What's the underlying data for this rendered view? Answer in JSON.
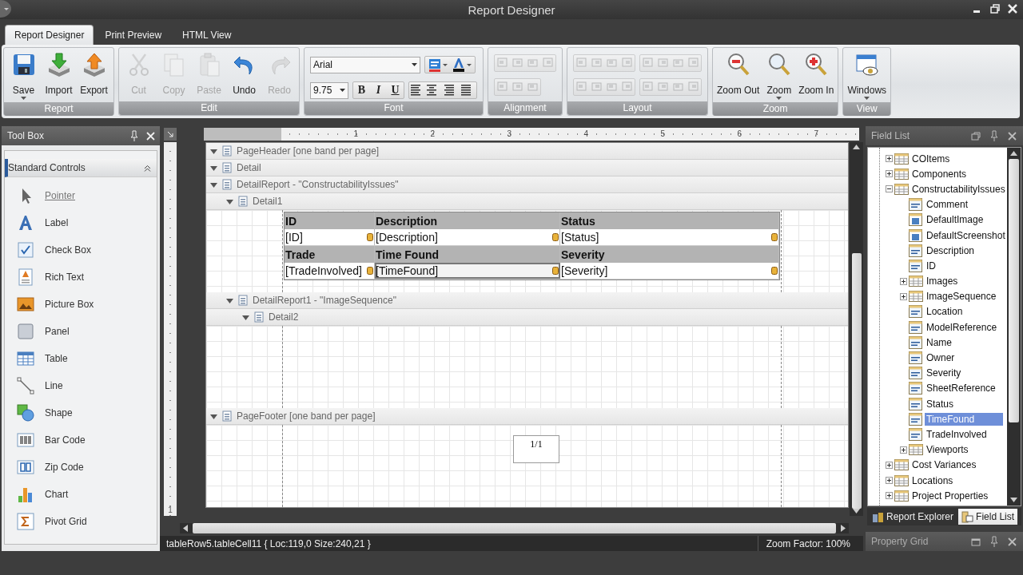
{
  "window": {
    "title": "Report Designer"
  },
  "ribbon": {
    "tabs": [
      {
        "label": "Report Designer",
        "selected": true
      },
      {
        "label": "Print Preview",
        "selected": false
      },
      {
        "label": "HTML View",
        "selected": false
      }
    ],
    "groups": [
      {
        "kind": "buttons",
        "label": "Report",
        "buttons": [
          {
            "label": "Save",
            "disabled": false,
            "dropdown": true
          },
          {
            "label": "Import",
            "disabled": false,
            "dropdown": false
          },
          {
            "label": "Export",
            "disabled": false,
            "dropdown": false
          }
        ]
      },
      {
        "kind": "buttons",
        "label": "Edit",
        "buttons": [
          {
            "label": "Cut",
            "disabled": true,
            "dropdown": false
          },
          {
            "label": "Copy",
            "disabled": true,
            "dropdown": false
          },
          {
            "label": "Paste",
            "disabled": true,
            "dropdown": false
          },
          {
            "label": "Undo",
            "disabled": false,
            "dropdown": false
          },
          {
            "label": "Redo",
            "disabled": true,
            "dropdown": false
          }
        ]
      },
      {
        "kind": "font",
        "label": "Font",
        "font": "Arial",
        "size": "9.75",
        "styles": [
          "B",
          "I",
          "U"
        ]
      },
      {
        "kind": "tools",
        "label": "Alignment"
      },
      {
        "kind": "tools",
        "label": "Layout"
      },
      {
        "kind": "buttons",
        "label": "Zoom",
        "buttons": [
          {
            "label": "Zoom Out",
            "disabled": false,
            "dropdown": false
          },
          {
            "label": "Zoom",
            "disabled": false,
            "dropdown": true
          },
          {
            "label": "Zoom In",
            "disabled": false,
            "dropdown": false
          }
        ]
      },
      {
        "kind": "buttons",
        "label": "View",
        "buttons": [
          {
            "label": "Windows",
            "disabled": false,
            "dropdown": true
          }
        ]
      }
    ]
  },
  "toolbox": {
    "title": "Tool Box",
    "category": {
      "label": "Standard Controls",
      "expanded": true
    },
    "items": [
      {
        "label": "Pointer",
        "selected": true
      },
      {
        "label": "Label",
        "selected": false
      },
      {
        "label": "Check Box",
        "selected": false
      },
      {
        "label": "Rich Text",
        "selected": false
      },
      {
        "label": "Picture Box",
        "selected": false
      },
      {
        "label": "Panel",
        "selected": false
      },
      {
        "label": "Table",
        "selected": false
      },
      {
        "label": "Line",
        "selected": false
      },
      {
        "label": "Shape",
        "selected": false
      },
      {
        "label": "Bar Code",
        "selected": false
      },
      {
        "label": "Zip Code",
        "selected": false
      },
      {
        "label": "Chart",
        "selected": false
      },
      {
        "label": "Pivot Grid",
        "selected": false
      }
    ]
  },
  "designer": {
    "ruler_labels": [
      "1",
      "2",
      "3",
      "4",
      "5",
      "6",
      "7"
    ],
    "vertical_ruler_labels": [
      "1"
    ],
    "bands": [
      {
        "label": "PageHeader [one band per page]",
        "kind": "header",
        "expanded": true
      },
      {
        "label": "Detail",
        "kind": "header",
        "expanded": true
      },
      {
        "label": "DetailReport - \"ConstructabilityIssues\"",
        "kind": "header",
        "expanded": true,
        "children": [
          {
            "label": "Detail1",
            "kind": "table",
            "expanded": true
          },
          {
            "label": "DetailReport1 - \"ImageSequence\"",
            "kind": "header",
            "expanded": true,
            "children": [
              {
                "label": "Detail2",
                "kind": "blank",
                "expanded": true
              }
            ]
          }
        ]
      },
      {
        "label": "PageFooter [one band per page]",
        "kind": "page-number",
        "expanded": true
      }
    ],
    "table": {
      "rows": [
        {
          "kind": "heading",
          "cells": [
            {
              "text": "ID",
              "selected": false
            },
            {
              "text": "Description",
              "selected": false
            },
            {
              "text": "Status",
              "selected": false
            }
          ]
        },
        {
          "kind": "data",
          "cells": [
            {
              "text": "[ID]",
              "selected": false
            },
            {
              "text": "[Description]",
              "selected": false
            },
            {
              "text": "[Status]",
              "selected": false
            }
          ]
        },
        {
          "kind": "heading",
          "cells": [
            {
              "text": "Trade",
              "selected": false
            },
            {
              "text": "Time Found",
              "selected": false
            },
            {
              "text": "Severity",
              "selected": false
            }
          ]
        },
        {
          "kind": "data",
          "cells": [
            {
              "text": "[TradeInvolved]",
              "selected": false
            },
            {
              "text": "[TimeFound]",
              "selected": true
            },
            {
              "text": "[Severity]",
              "selected": false
            }
          ]
        }
      ]
    },
    "page_number": "1/1"
  },
  "status_bar": {
    "selection": "tableRow5.tableCell11 { Loc:119,0 Size:240,21 }",
    "zoom": "Zoom Factor: 100%"
  },
  "field_list": {
    "title": "Field List",
    "tree": [
      {
        "label": "COItems",
        "kind": "table",
        "expanded": false,
        "selected": false
      },
      {
        "label": "Components",
        "kind": "table",
        "expanded": false,
        "selected": false
      },
      {
        "label": "ConstructabilityIssues",
        "kind": "table",
        "expanded": true,
        "selected": false,
        "children": [
          {
            "label": "Comment",
            "kind": "field",
            "selected": false
          },
          {
            "label": "DefaultImage",
            "kind": "image",
            "selected": false
          },
          {
            "label": "DefaultScreenshot",
            "kind": "image",
            "selected": false
          },
          {
            "label": "Description",
            "kind": "field",
            "selected": false
          },
          {
            "label": "ID",
            "kind": "field",
            "selected": false
          },
          {
            "label": "Images",
            "kind": "table",
            "expanded": false,
            "selected": false
          },
          {
            "label": "ImageSequence",
            "kind": "table",
            "expanded": false,
            "selected": false
          },
          {
            "label": "Location",
            "kind": "field",
            "selected": false
          },
          {
            "label": "ModelReference",
            "kind": "field",
            "selected": false
          },
          {
            "label": "Name",
            "kind": "field",
            "selected": false
          },
          {
            "label": "Owner",
            "kind": "field",
            "selected": false
          },
          {
            "label": "Severity",
            "kind": "field",
            "selected": false
          },
          {
            "label": "SheetReference",
            "kind": "field",
            "selected": false
          },
          {
            "label": "Status",
            "kind": "field",
            "selected": false
          },
          {
            "label": "TimeFound",
            "kind": "field",
            "selected": true
          },
          {
            "label": "TradeInvolved",
            "kind": "field",
            "selected": false
          },
          {
            "label": "Viewports",
            "kind": "table",
            "expanded": false,
            "selected": false
          }
        ]
      },
      {
        "label": "Cost Variances",
        "kind": "table",
        "expanded": false,
        "selected": false
      },
      {
        "label": "Locations",
        "kind": "table",
        "expanded": false,
        "selected": false
      },
      {
        "label": "Project Properties",
        "kind": "table",
        "expanded": false,
        "selected": false
      }
    ],
    "tabs": [
      {
        "label": "Report Explorer",
        "selected": false
      },
      {
        "label": "Field List",
        "selected": true
      }
    ]
  },
  "property_grid": {
    "title": "Property Grid"
  }
}
